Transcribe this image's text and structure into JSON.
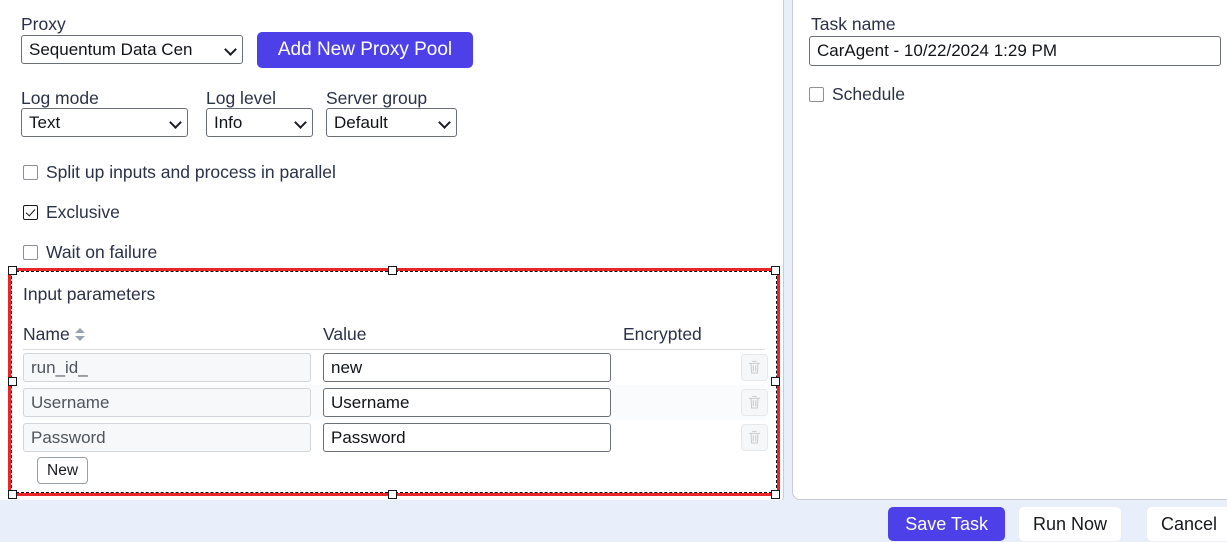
{
  "left_panel": {
    "proxy": {
      "label": "Proxy",
      "selected": "Sequentum Data Cen",
      "add_button": "Add New Proxy Pool"
    },
    "log_mode": {
      "label": "Log mode",
      "selected": "Text"
    },
    "log_level": {
      "label": "Log level",
      "selected": "Info"
    },
    "server_group": {
      "label": "Server group",
      "selected": "Default"
    },
    "checkboxes": [
      {
        "label": "Split up inputs and process in parallel",
        "checked": false
      },
      {
        "label": "Exclusive",
        "checked": true
      },
      {
        "label": "Wait on failure",
        "checked": false
      }
    ]
  },
  "input_parameters": {
    "title": "Input parameters",
    "columns": [
      "Name",
      "Value",
      "Encrypted"
    ],
    "sort_icon": "sort-updown-icon",
    "delete_icon": "trash-icon",
    "rows": [
      {
        "name": "run_id_",
        "value": "new",
        "encrypted": ""
      },
      {
        "name": "Username",
        "value": "Username",
        "encrypted": ""
      },
      {
        "name": "Password",
        "value": "Password",
        "encrypted": ""
      }
    ],
    "new_button": "New"
  },
  "right_panel": {
    "task_name": {
      "label": "Task name",
      "value": "CarAgent - 10/22/2024 1:29 PM"
    },
    "schedule": {
      "label": "Schedule",
      "checked": false
    }
  },
  "action_bar": {
    "save": "Save Task",
    "run": "Run Now",
    "cancel": "Cancel"
  },
  "colors": {
    "accent": "#4d40e8",
    "selection": "#e8262a",
    "page_background": "#e9eefb"
  }
}
